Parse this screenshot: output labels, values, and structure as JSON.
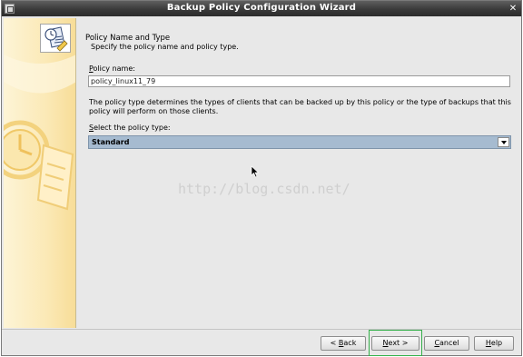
{
  "window": {
    "title": "Backup Policy Configuration Wizard"
  },
  "header": {
    "title": "Policy Name and Type",
    "subtitle": "Specify the policy name and policy type."
  },
  "policy_name": {
    "label_mnemonic": "P",
    "label_rest": "olicy name:",
    "value": "policy_linux11_79"
  },
  "description": "The policy type determines the types of clients that can be backed up by this policy or the type of backups that this policy will perform on those clients.",
  "policy_type": {
    "label_mnemonic": "S",
    "label_rest": "elect the policy type:",
    "selected": "Standard"
  },
  "watermark": "http://blog.csdn.net/",
  "buttons": {
    "back_prefix": "< ",
    "back_mnemonic": "B",
    "back_rest": "ack",
    "next_mnemonic": "N",
    "next_rest": "ext >",
    "cancel_mnemonic": "C",
    "cancel_rest": "ancel",
    "help_mnemonic": "H",
    "help_rest": "elp"
  },
  "colors": {
    "title_bar": "#3a3a3a",
    "select_highlight": "#a6bbd0",
    "focus_ring": "#35b04a",
    "sidebar": "#fbe9b6"
  },
  "icons": [
    "window-menu-icon",
    "close-icon",
    "wizard-policy-icon",
    "clock-watermark-icon",
    "dropdown-arrow-icon",
    "mouse-pointer-icon"
  ]
}
